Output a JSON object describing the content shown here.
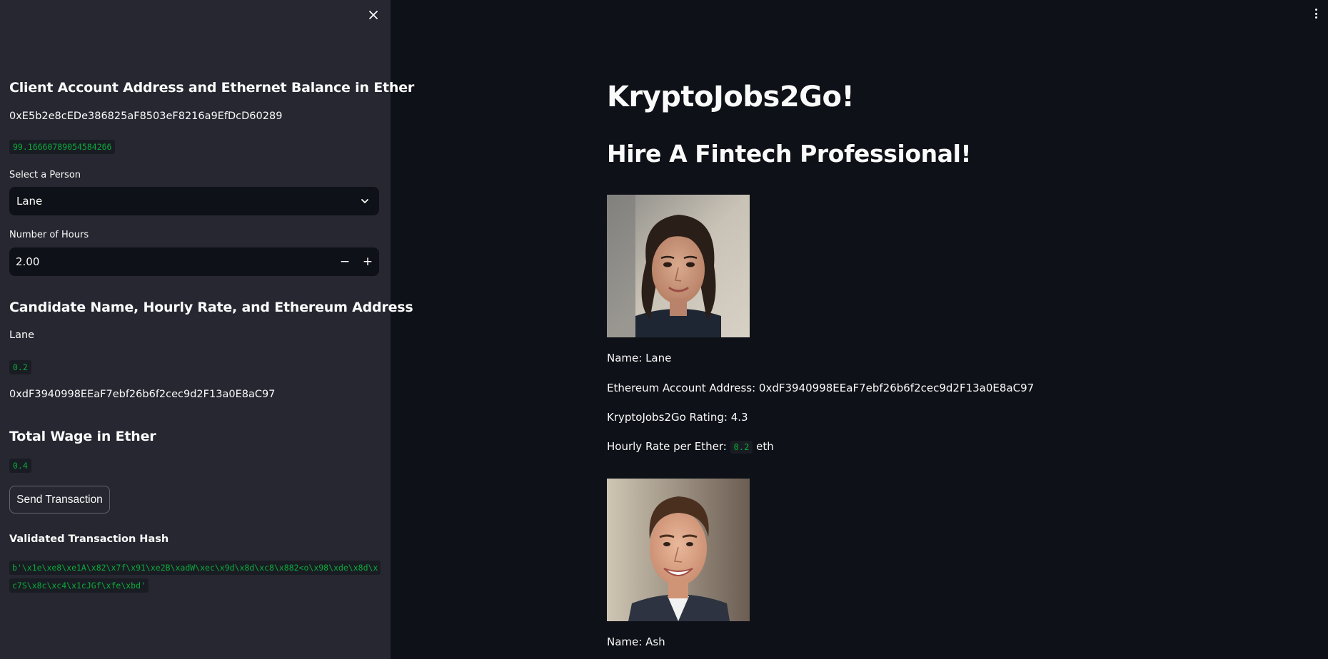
{
  "sidebar": {
    "client_heading": "Client Account Address and Ethernet Balance in Ether",
    "client_address": "0xE5b2e8cEDe386825aF8503eF8216a9EfDcD60289",
    "client_balance": "99.16660789054584266",
    "select_person": {
      "label": "Select a Person",
      "value": "Lane"
    },
    "hours": {
      "label": "Number of Hours",
      "value": "2.00",
      "decrement": "−",
      "increment": "+"
    },
    "candidate_heading": "Candidate Name, Hourly Rate, and Ethereum Address",
    "candidate_name": "Lane",
    "candidate_rate": "0.2",
    "candidate_address": "0xdF3940998EEaF7ebf26b6f2cec9d2F13a0E8aC97",
    "wage_heading": "Total Wage in Ether",
    "wage_value": "0.4",
    "send_button": "Send Transaction",
    "hash_heading": "Validated Transaction Hash",
    "hash_value": "b'\\x1e\\xe8\\xe1A\\x82\\x7f\\x91\\xe2B\\xadW\\xec\\x9d\\x8d\\xc8\\x882<o\\x98\\xde\\x8d\\xc7S\\x8c\\xc4\\x1cJGf\\xfe\\xbd'"
  },
  "main": {
    "title": "KryptoJobs2Go!",
    "subtitle": "Hire A Fintech Professional!",
    "candidates": [
      {
        "name_line": "Name: Lane",
        "address_line": "Ethereum Account Address: 0xdF3940998EEaF7ebf26b6f2cec9d2F13a0E8aC97",
        "rating_line": "KryptoJobs2Go Rating: 4.3",
        "rate_prefix": "Hourly Rate per Ether:",
        "rate_value": "0.2",
        "rate_suffix": "eth"
      },
      {
        "name_line": "Name: Ash"
      }
    ]
  },
  "colors": {
    "sidebar_bg": "#262730",
    "main_bg": "#0e1117",
    "code_green": "#09ab3b",
    "text": "#fafafa"
  },
  "icons": [
    "close-icon",
    "chevron-down-icon",
    "minus-icon",
    "plus-icon",
    "kebab-menu-icon"
  ]
}
